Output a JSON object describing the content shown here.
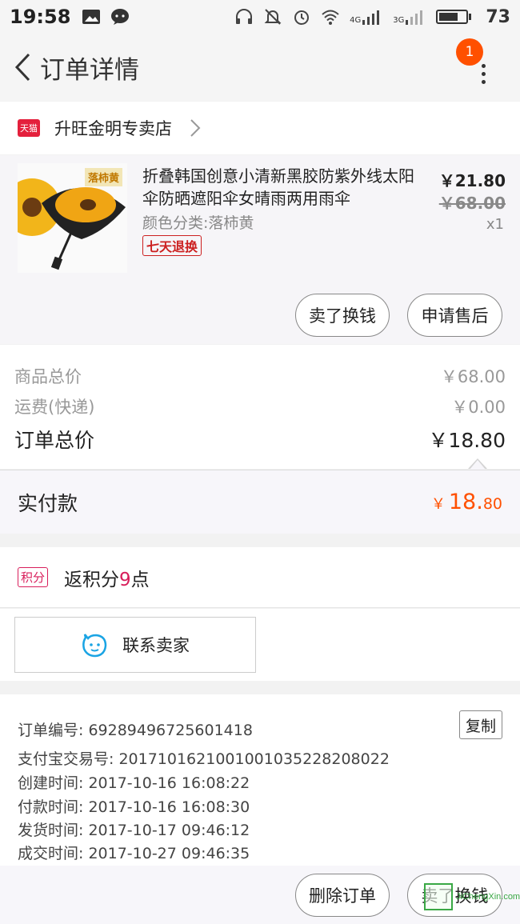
{
  "status_bar": {
    "time": "19:58",
    "battery_percent": "73",
    "net_4g": "4G",
    "net_3g": "3G"
  },
  "nav": {
    "title": "订单详情",
    "badge_count": "1"
  },
  "shop": {
    "logo_text": "天猫",
    "name": "升旺金明专卖店"
  },
  "item": {
    "thumb_label": "落柿黄",
    "title": "折叠韩国创意小清新黑胶防紫外线太阳伞防晒遮阳伞女晴雨两用雨伞",
    "sku": "颜色分类:落柿黄",
    "tag": "七天退换",
    "price": "￥21.80",
    "original_price": "￥68.00",
    "quantity": "x1",
    "btn_sell": "卖了换钱",
    "btn_after_sale": "申请售后"
  },
  "summary": {
    "goods_total_label": "商品总价",
    "goods_total_value": "￥68.00",
    "shipping_label": "运费(快递)",
    "shipping_value": "￥0.00",
    "order_total_label": "订单总价",
    "order_total_value": "￥18.80"
  },
  "paid": {
    "label": "实付款",
    "currency": "￥",
    "amount_int": "18.",
    "amount_dec": "80"
  },
  "points": {
    "tag": "积分",
    "text_prefix": "返积分",
    "number": "9",
    "text_suffix": "点"
  },
  "contact": {
    "label": "联系卖家"
  },
  "order_info": {
    "order_no": "订单编号: 69289496725601418",
    "alipay_no": "支付宝交易号: 2017101621001001035228208022",
    "created": "创建时间: 2017-10-16 16:08:22",
    "paid_time": "付款时间: 2017-10-16 16:08:30",
    "shipped": "发货时间: 2017-10-17 09:46:12",
    "completed": "成交时间: 2017-10-27 09:46:35",
    "copy_label": "复制"
  },
  "bottom": {
    "delete_label": "删除订单",
    "sell_label": "卖了换钱"
  },
  "watermark": {
    "text": "JiChengXin.com"
  },
  "colors": {
    "accent_orange": "#ff5000",
    "tmall_red": "#e4203c",
    "points_pink": "#d81e5b",
    "tag_red": "#cc2020"
  }
}
